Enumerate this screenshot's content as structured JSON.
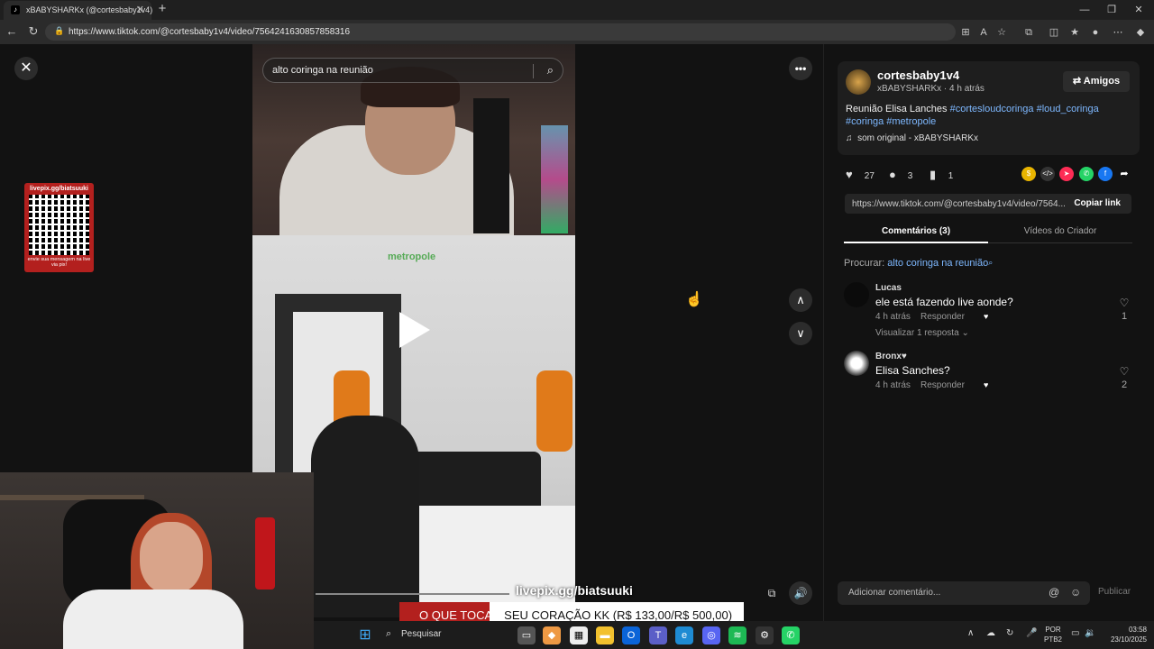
{
  "browser": {
    "tab_title": "xBABYSHARKx (@cortesbaby1v4)",
    "url": "https://www.tiktok.com/@cortesbaby1v4/video/7564241630857858316"
  },
  "video": {
    "search_query": "alto coringa na reunião",
    "game_logo": "metropole",
    "qr_header": "livepix.gg/biatsuuki",
    "qr_footer": "envie sua mensagem na live via pix!",
    "livepix_text": "livepix.gg/biatsuuki",
    "ticker_red": "O QUE TOCAR",
    "ticker_text": "SEU CORAÇÃO KK (R$ 133,00/R$ 500,00)"
  },
  "creator": {
    "username": "cortesbaby1v4",
    "meta": "xBABYSHARKx · 4 h atrás",
    "friends_button": "Amigos",
    "description_text": "Reunião Elisa Lanches ",
    "tags": [
      "#cortesloudcoringa",
      "#loud_coringa",
      "#coringa",
      "#metropole"
    ],
    "sound": "som original - xBABYSHARKx"
  },
  "stats": {
    "likes": "27",
    "comments": "3",
    "saves": "1"
  },
  "share": {
    "link": "https://www.tiktok.com/@cortesbaby1v4/video/7564...",
    "copy_button": "Copiar link"
  },
  "tabs": {
    "comments": "Comentários (3)",
    "creator_videos": "Vídeos do Criador"
  },
  "search_hint": {
    "label": "Procurar: ",
    "link": "alto coringa na reunião"
  },
  "comments": [
    {
      "name": "Lucas",
      "text": "ele está fazendo live aonde?",
      "time": "4 h atrás",
      "reply": "Responder",
      "likes": "1",
      "view_replies": "Visualizar 1 resposta"
    },
    {
      "name": "Bronx♥",
      "text": "Elisa Sanches?",
      "time": "4 h atrás",
      "reply": "Responder",
      "likes": "2"
    }
  ],
  "composer": {
    "placeholder": "Adicionar comentário...",
    "publish": "Publicar"
  },
  "taskbar": {
    "search": "Pesquisar",
    "lang_top": "POR",
    "lang_bottom": "PTB2",
    "time": "03:58",
    "date": "23/10/2025"
  }
}
